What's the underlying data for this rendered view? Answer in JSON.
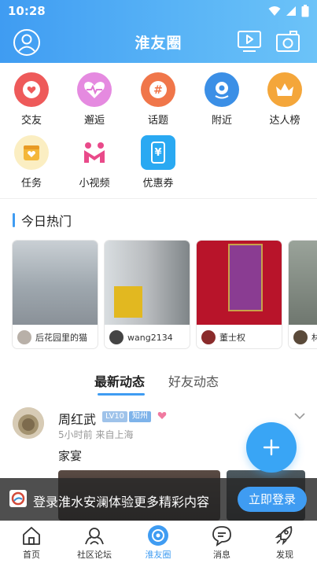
{
  "status_bar": {
    "time": "10:28"
  },
  "header": {
    "title": "淮友圈"
  },
  "quick_grid": [
    {
      "label": "交友",
      "icon": "heart-icon",
      "color": "#ee5a5a"
    },
    {
      "label": "邂逅",
      "icon": "pulse-heart-icon",
      "color": "#e079d6"
    },
    {
      "label": "话题",
      "icon": "hashtag-icon",
      "color": "#f0764a"
    },
    {
      "label": "附近",
      "icon": "location-icon",
      "color": "#3b8fe6"
    },
    {
      "label": "达人榜",
      "icon": "crown-icon",
      "color": "#f4a63a"
    },
    {
      "label": "任务",
      "icon": "task-icon",
      "color": "#f4b73a"
    },
    {
      "label": "小视频",
      "icon": "video-m-icon",
      "color": "#e94a8a"
    },
    {
      "label": "优惠券",
      "icon": "coupon-icon",
      "color": "#2aa9f2"
    }
  ],
  "hot": {
    "title": "今日热门",
    "cards": [
      {
        "user": "后花园里的猫"
      },
      {
        "user": "wang2134"
      },
      {
        "user": "董士权"
      },
      {
        "user": "林"
      }
    ]
  },
  "feed_tabs": {
    "active": "最新动态",
    "inactive": "好友动态"
  },
  "post": {
    "username": "周红武",
    "level": "LV10",
    "city": "知州",
    "time": "5小时前  来自上海",
    "text": "家宴"
  },
  "banner": {
    "message": "登录淮水安澜体验更多精彩内容",
    "button": "立即登录"
  },
  "bottom_nav": [
    {
      "label": "首页"
    },
    {
      "label": "社区论坛"
    },
    {
      "label": "淮友圈"
    },
    {
      "label": "消息"
    },
    {
      "label": "发现"
    }
  ]
}
